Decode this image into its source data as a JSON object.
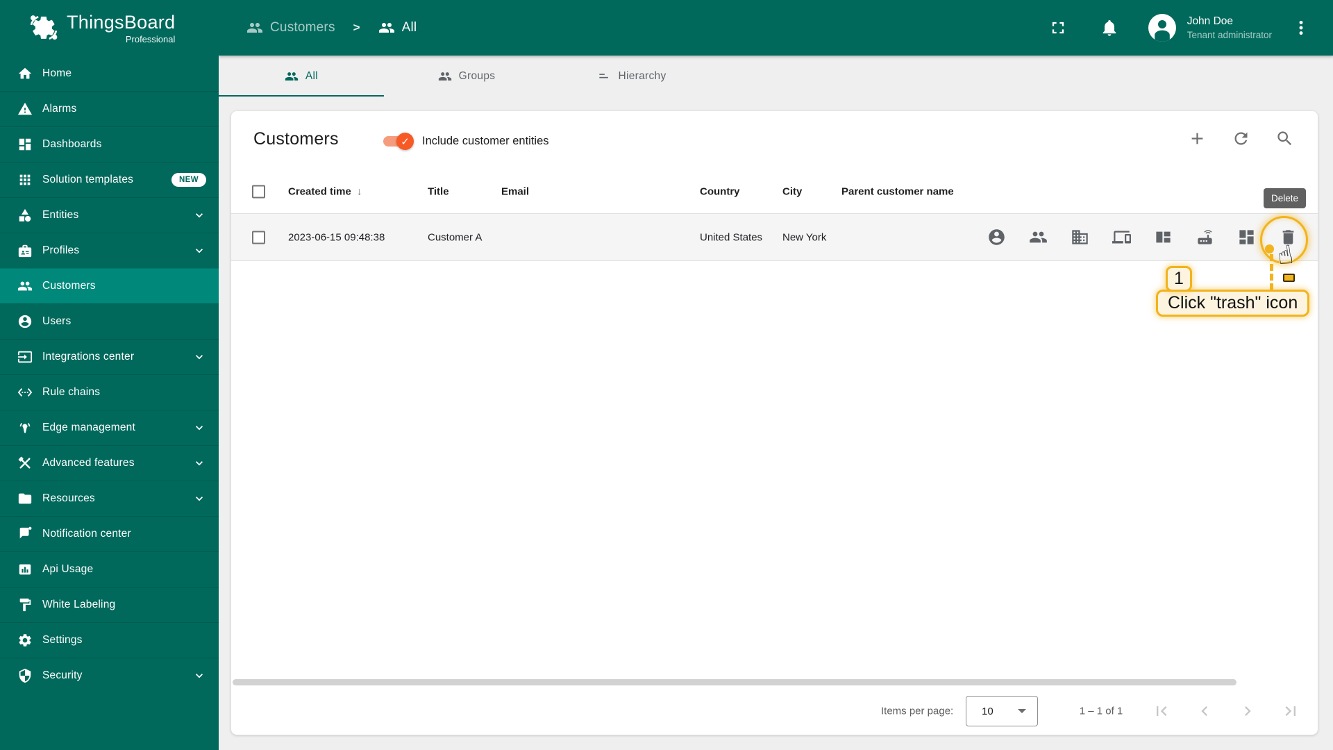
{
  "app": {
    "name": "ThingsBoard",
    "edition": "Professional"
  },
  "colors": {
    "primary_teal": "#00695c",
    "selected_teal": "#00897b",
    "accent_orange": "#f85a25",
    "annotation_gold": "#f2b31c",
    "tooltip_bg": "#616161",
    "page_bg": "#efeff0"
  },
  "sidebar": {
    "items": [
      {
        "label": "Home"
      },
      {
        "label": "Alarms"
      },
      {
        "label": "Dashboards"
      },
      {
        "label": "Solution templates",
        "badge": "NEW"
      },
      {
        "label": "Entities",
        "expandable": true
      },
      {
        "label": "Profiles",
        "expandable": true
      },
      {
        "label": "Customers",
        "selected": true
      },
      {
        "label": "Users"
      },
      {
        "label": "Integrations center",
        "expandable": true
      },
      {
        "label": "Rule chains"
      },
      {
        "label": "Edge management",
        "expandable": true
      },
      {
        "label": "Advanced features",
        "expandable": true
      },
      {
        "label": "Resources",
        "expandable": true
      },
      {
        "label": "Notification center"
      },
      {
        "label": "Api Usage"
      },
      {
        "label": "White Labeling"
      },
      {
        "label": "Settings"
      },
      {
        "label": "Security",
        "expandable": true
      }
    ]
  },
  "header": {
    "breadcrumb": [
      "Customers",
      "All"
    ],
    "separator": ">",
    "user": {
      "name": "John Doe",
      "role": "Tenant administrator"
    }
  },
  "tabs": [
    {
      "label": "All",
      "active": true
    },
    {
      "label": "Groups"
    },
    {
      "label": "Hierarchy"
    }
  ],
  "panel": {
    "title": "Customers",
    "toggle_label": "Include customer entities",
    "toggle_on": true
  },
  "table": {
    "columns": {
      "created": "Created time",
      "title": "Title",
      "email": "Email",
      "country": "Country",
      "city": "City",
      "parent": "Parent customer name"
    },
    "sort_arrow": "↓",
    "rows": [
      {
        "created": "2023-06-15 09:48:38",
        "title": "Customer A",
        "email": "",
        "country": "United States",
        "city": "New York",
        "parent": ""
      }
    ]
  },
  "tooltip": {
    "text": "Delete"
  },
  "annotation": {
    "step": "1",
    "label": "Click \"trash\" icon"
  },
  "pagination": {
    "items_per_page_label": "Items per page:",
    "items_per_page": "10",
    "range": "1 – 1 of 1"
  }
}
